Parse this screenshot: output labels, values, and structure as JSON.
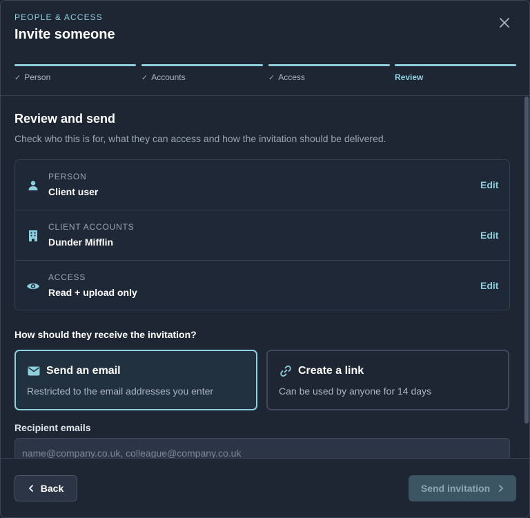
{
  "header": {
    "eyebrow": "PEOPLE & ACCESS",
    "title": "Invite someone"
  },
  "steps": [
    {
      "label": "Person",
      "completed": true
    },
    {
      "label": "Accounts",
      "completed": true
    },
    {
      "label": "Access",
      "completed": true
    },
    {
      "label": "Review",
      "completed": false,
      "active": true
    }
  ],
  "review": {
    "title": "Review and send",
    "description": "Check who this is for, what they can access and how the invitation should be delivered.",
    "rows": [
      {
        "label": "PERSON",
        "value": "Client user",
        "icon": "person-icon",
        "edit": "Edit"
      },
      {
        "label": "CLIENT ACCOUNTS",
        "value": "Dunder Mifflin",
        "icon": "building-icon",
        "edit": "Edit"
      },
      {
        "label": "ACCESS",
        "value": "Read + upload only",
        "icon": "eye-icon",
        "edit": "Edit"
      }
    ]
  },
  "delivery": {
    "question": "How should they receive the invitation?",
    "options": [
      {
        "title": "Send an email",
        "description": "Restricted to the email addresses you enter",
        "icon": "envelope-icon",
        "selected": true
      },
      {
        "title": "Create a link",
        "description": "Can be used by anyone for 14 days",
        "icon": "link-icon",
        "selected": false
      }
    ]
  },
  "recipients": {
    "label": "Recipient emails",
    "placeholder": "name@company.co.uk, colleague@company.co.uk",
    "value": ""
  },
  "footer": {
    "back_label": "Back",
    "send_label": "Send invitation"
  },
  "colors": {
    "accent": "#8fd0de",
    "background": "#1e2633",
    "border": "#334052"
  }
}
